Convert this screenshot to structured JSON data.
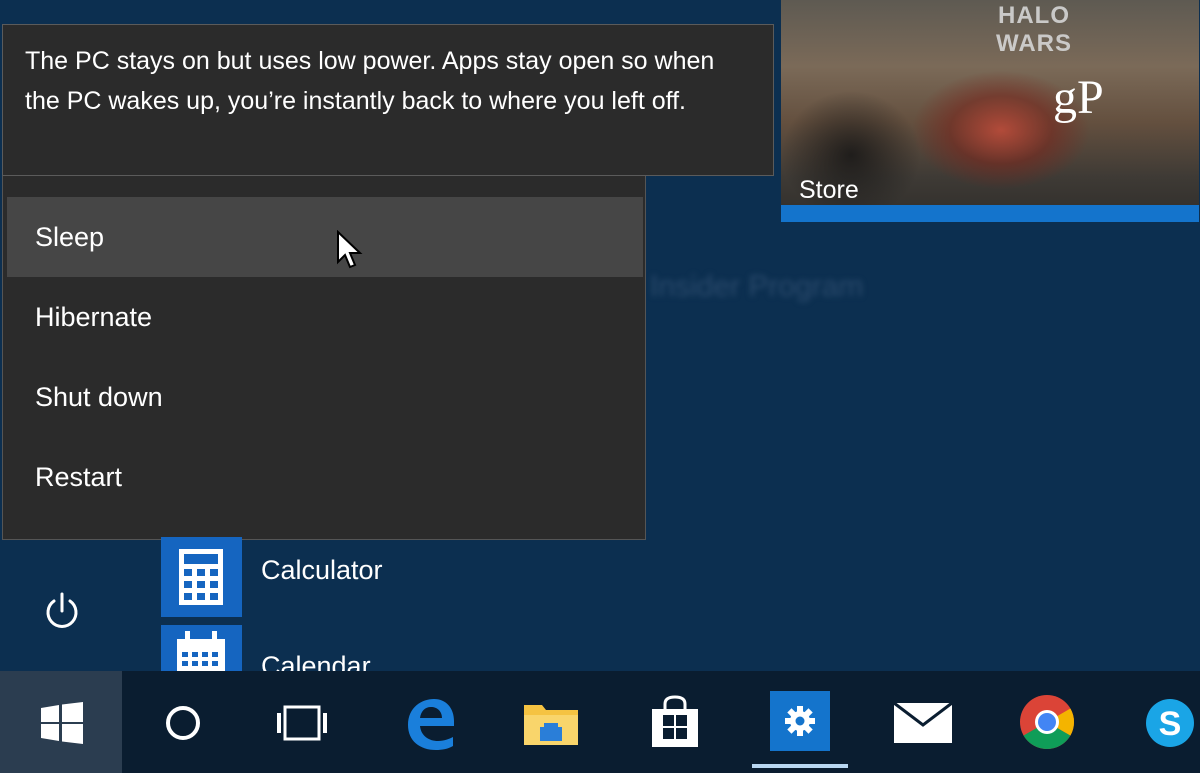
{
  "tooltip": {
    "text": "The PC stays on but uses low power. Apps stay open so when the PC wakes up, you’re instantly back to where you left off."
  },
  "store_tile": {
    "label": "Store",
    "game_logo": "HALO WARS",
    "watermark": "gP"
  },
  "power_menu": {
    "items": [
      {
        "label": "Sleep",
        "state": "hover"
      },
      {
        "label": "Hibernate"
      },
      {
        "label": "Shut down"
      },
      {
        "label": "Restart"
      }
    ]
  },
  "background_text": "Insider Program",
  "apps": [
    {
      "label": "Calculator",
      "icon": "calculator-icon"
    },
    {
      "label": "Calendar",
      "icon": "calendar-icon"
    }
  ],
  "taskbar": {
    "items": [
      "windows-start-icon",
      "cortana-icon",
      "task-view-icon",
      "edge-icon",
      "file-explorer-icon",
      "store-icon",
      "settings-icon",
      "mail-icon",
      "chrome-icon",
      "skype-icon"
    ],
    "active": "settings-icon"
  },
  "colors": {
    "start_bg": "#0c2f50",
    "menu_bg": "#2b2b2b",
    "hover_bg": "#464646",
    "accent": "#1474cc",
    "taskbar_bg": "#0a1d30"
  }
}
